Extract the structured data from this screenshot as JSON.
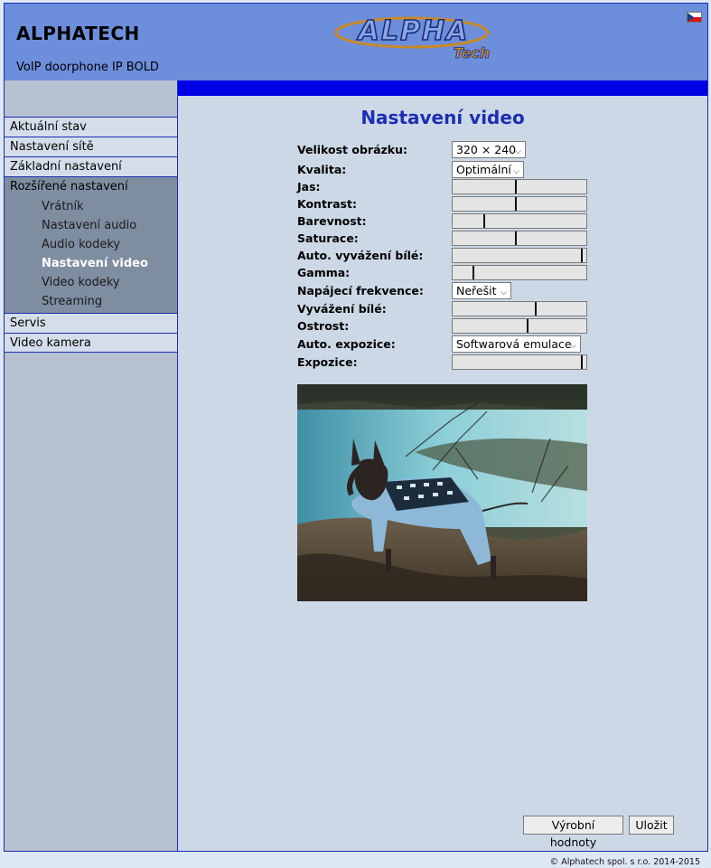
{
  "header": {
    "brand": "ALPHATECH",
    "model": "VoIP doorphone IP BOLD",
    "logo_text_main": "ALPHA",
    "logo_text_sub": "Tech",
    "language_flag": "czech-flag-icon"
  },
  "sidebar": {
    "items": [
      {
        "label": "Aktuální stav"
      },
      {
        "label": "Nastavení sítě"
      },
      {
        "label": "Základní nastavení"
      }
    ],
    "group": {
      "label": "Rozšířené nastavení",
      "subitems": [
        {
          "label": "Vrátník"
        },
        {
          "label": "Nastavení audio"
        },
        {
          "label": "Audio kodeky"
        },
        {
          "label": "Nastavení video"
        },
        {
          "label": "Video kodeky"
        },
        {
          "label": "Streaming"
        }
      ]
    },
    "items_after": [
      {
        "label": "Servis"
      },
      {
        "label": "Video kamera"
      }
    ]
  },
  "main": {
    "title": "Nastavení video",
    "fields": {
      "image_size": {
        "label": "Velikost obrázku:",
        "value": "320 × 240"
      },
      "quality": {
        "label": "Kvalita:",
        "value": "Optimální"
      },
      "brightness": {
        "label": "Jas:",
        "level": 0.47
      },
      "contrast": {
        "label": "Kontrast:",
        "level": 0.47
      },
      "color": {
        "label": "Barevnost:",
        "level": 0.23
      },
      "saturation": {
        "label": "Saturace:",
        "level": 0.47
      },
      "auto_white_balance": {
        "label": "Auto. vyvážení bílé:",
        "level": 0.97
      },
      "gamma": {
        "label": "Gamma:",
        "level": 0.15
      },
      "power_frequency": {
        "label": "Napájecí frekvence:",
        "value": "Neřešit"
      },
      "white_balance": {
        "label": "Vyvážení bílé:",
        "level": 0.62
      },
      "sharpness": {
        "label": "Ostrost:",
        "level": 0.56
      },
      "auto_exposure": {
        "label": "Auto. expozice:",
        "value": "Softwarová emulace"
      },
      "exposure": {
        "label": "Expozice:",
        "level": 0.97
      }
    },
    "buttons": {
      "defaults": "Výrobní hodnoty",
      "save": "Uložit"
    }
  },
  "footer": {
    "copyright": "© Alphatech spol. s r.o. 2014-2015"
  },
  "colors": {
    "header_bg": "#6c8edb",
    "accent_bar": "#0000e6",
    "title": "#1c2fb4",
    "active_menu_text": "#ffffff"
  }
}
